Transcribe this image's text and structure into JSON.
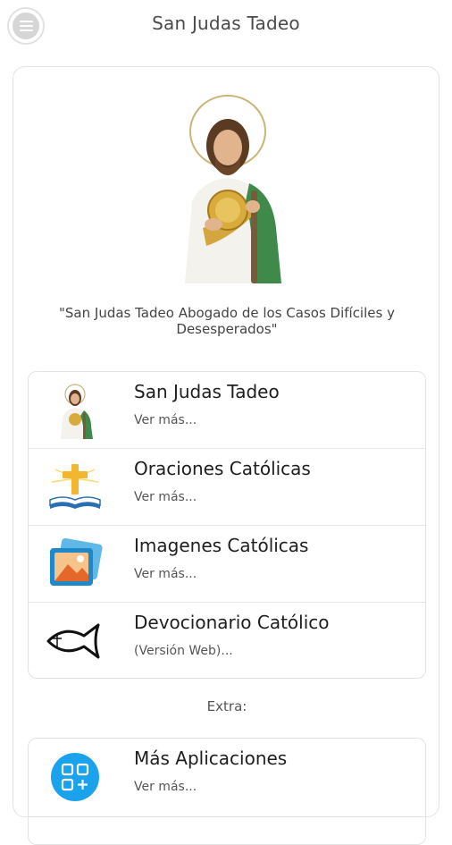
{
  "header": {
    "title": "San Judas Tadeo",
    "menu_icon": "hamburger-menu-icon"
  },
  "hero": {
    "image": "saint-jude-statue",
    "quote": "\"San Judas Tadeo Abogado de los Casos Difíciles y Desesperados\""
  },
  "menu": {
    "items": [
      {
        "title": "San Judas Tadeo",
        "subtitle": "Ver más...",
        "icon": "saint-jude-icon"
      },
      {
        "title": "Oraciones Católicas",
        "subtitle": "Ver más...",
        "icon": "cross-bible-icon"
      },
      {
        "title": "Imagenes Católicas",
        "subtitle": "Ver más...",
        "icon": "image-gallery-icon"
      },
      {
        "title": "Devocionario Católico",
        "subtitle": "(Versión Web)...",
        "icon": "ichthys-fish-icon"
      }
    ]
  },
  "extra": {
    "label": "Extra:",
    "items": [
      {
        "title": "Más Aplicaciones",
        "subtitle": "Ver más...",
        "icon": "apps-plus-icon"
      }
    ]
  },
  "colors": {
    "apps_icon_blue": "#1aa3ec",
    "image_icon_blue": "#1e88c8",
    "cross_gold": "#f2b630"
  }
}
